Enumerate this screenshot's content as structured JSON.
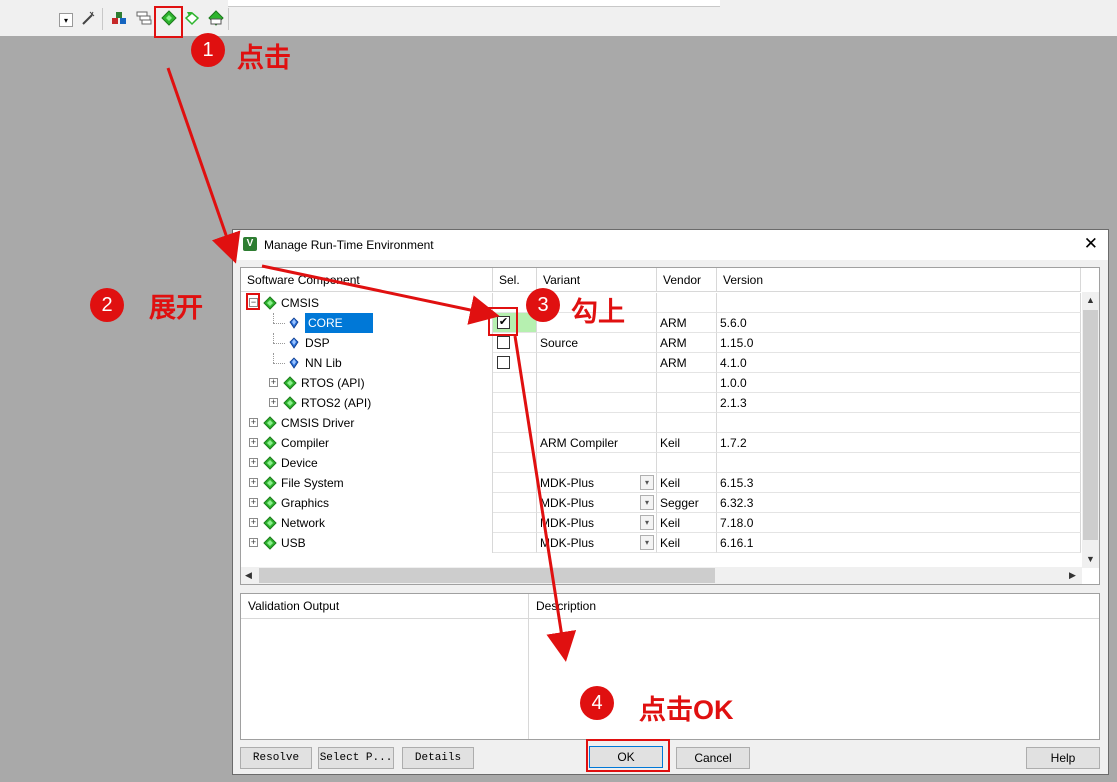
{
  "dialog": {
    "title": "Manage Run-Time Environment",
    "close_glyph": "✕"
  },
  "grid": {
    "columns": [
      "Software Component",
      "Sel.",
      "Variant",
      "Vendor",
      "Version"
    ],
    "rows": [
      {
        "name": "CMSIS",
        "level": 0,
        "expander": "−",
        "sel": "",
        "variant": "",
        "vendor": "",
        "version": "",
        "icon": "green-diamond-icon"
      },
      {
        "name": "CORE",
        "level": 2,
        "expander": "",
        "sel": "✔",
        "variant": "",
        "vendor": "ARM",
        "version": "5.6.0",
        "icon": "blue-gem-icon",
        "selected": true
      },
      {
        "name": "DSP",
        "level": 2,
        "expander": "",
        "sel": "",
        "variant": "Source",
        "vendor": "ARM",
        "version": "1.15.0",
        "icon": "blue-gem-icon"
      },
      {
        "name": "NN Lib",
        "level": 2,
        "expander": "",
        "sel": "",
        "variant": "",
        "vendor": "ARM",
        "version": "4.1.0",
        "icon": "blue-gem-icon"
      },
      {
        "name": "RTOS (API)",
        "level": 1,
        "expander": "+",
        "sel": "",
        "variant": "",
        "vendor": "",
        "version": "1.0.0",
        "icon": "green-diamond-icon"
      },
      {
        "name": "RTOS2 (API)",
        "level": 1,
        "expander": "+",
        "sel": "",
        "variant": "",
        "vendor": "",
        "version": "2.1.3",
        "icon": "green-diamond-icon"
      },
      {
        "name": "CMSIS Driver",
        "level": 0,
        "expander": "+",
        "sel": "",
        "variant": "",
        "vendor": "",
        "version": "",
        "icon": "green-diamond-icon"
      },
      {
        "name": "Compiler",
        "level": 0,
        "expander": "+",
        "sel": "",
        "variant": "ARM Compiler",
        "vendor": "Keil",
        "version": "1.7.2",
        "icon": "green-diamond-icon"
      },
      {
        "name": "Device",
        "level": 0,
        "expander": "+",
        "sel": "",
        "variant": "",
        "vendor": "",
        "version": "",
        "icon": "green-diamond-icon"
      },
      {
        "name": "File System",
        "level": 0,
        "expander": "+",
        "sel": "",
        "variant": "MDK-Plus",
        "vendor": "Keil",
        "version": "6.15.3",
        "icon": "green-diamond-icon",
        "dropdown": true
      },
      {
        "name": "Graphics",
        "level": 0,
        "expander": "+",
        "sel": "",
        "variant": "MDK-Plus",
        "vendor": "Segger",
        "version": "6.32.3",
        "icon": "green-diamond-icon",
        "dropdown": true
      },
      {
        "name": "Network",
        "level": 0,
        "expander": "+",
        "sel": "",
        "variant": "MDK-Plus",
        "vendor": "Keil",
        "version": "7.18.0",
        "icon": "green-diamond-icon",
        "dropdown": true
      },
      {
        "name": "USB",
        "level": 0,
        "expander": "+",
        "sel": "",
        "variant": "MDK-Plus",
        "vendor": "Keil",
        "version": "6.16.1",
        "icon": "green-diamond-icon",
        "dropdown": true
      }
    ]
  },
  "panels": {
    "validation_output": "Validation Output",
    "description": "Description"
  },
  "buttons": {
    "resolve": "Resolve",
    "select_packs": "Select P...",
    "details": "Details",
    "ok": "OK",
    "cancel": "Cancel",
    "help": "Help"
  },
  "annotations": [
    {
      "number": "1",
      "text": "点击"
    },
    {
      "number": "2",
      "text": "展开"
    },
    {
      "number": "3",
      "text": "勾上"
    },
    {
      "number": "4",
      "text": "点击OK"
    }
  ],
  "colors": {
    "annotation_red": "#e01010",
    "selection_blue": "#0078d7",
    "sel_column_green": "#b6f0b0",
    "component_green": "#2fb52f"
  }
}
